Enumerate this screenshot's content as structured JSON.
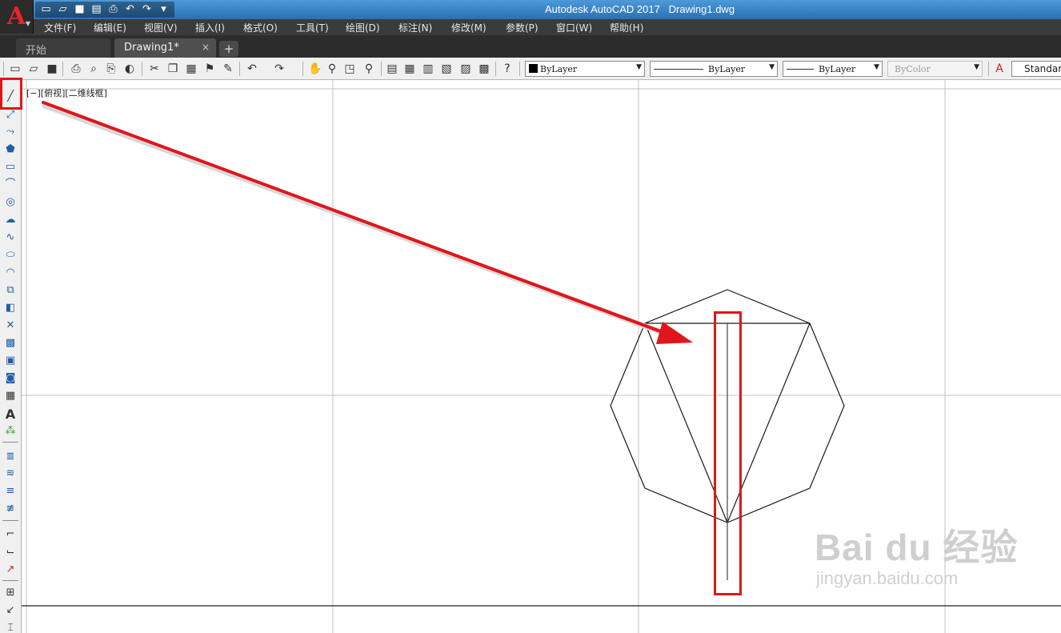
{
  "title_bar": {
    "app_name": "Autodesk AutoCAD 2017",
    "document": "Drawing1.dwg"
  },
  "app_button": {
    "letter": "A",
    "icon": "autocad-logo-icon"
  },
  "quick_access": [
    "new-icon",
    "open-icon",
    "save-icon",
    "save-as-icon",
    "plot-icon",
    "undo-icon",
    "redo-icon",
    "customize-dropdown-icon"
  ],
  "menu": [
    "文件(F)",
    "编辑(E)",
    "视图(V)",
    "插入(I)",
    "格式(O)",
    "工具(T)",
    "绘图(D)",
    "标注(N)",
    "修改(M)",
    "参数(P)",
    "窗口(W)",
    "帮助(H)"
  ],
  "tabs": [
    {
      "label": "开始",
      "active": false
    },
    {
      "label": "Drawing1*",
      "active": true,
      "close": "×"
    }
  ],
  "new_tab_label": "+",
  "toolbar": {
    "color_combo": "ByLayer",
    "linetype_combo": "ByLayer",
    "lineweight_combo": "ByLayer",
    "plotstyle_combo": "ByColor",
    "text_style": "Standard"
  },
  "left_toolbar": [
    "line-icon",
    "construction-line-icon",
    "polyline-icon",
    "polygon-icon",
    "rectangle-icon",
    "arc-icon",
    "circle-icon",
    "revision-cloud-icon",
    "spline-icon",
    "ellipse-icon",
    "ellipse-arc-icon",
    "insert-block-icon",
    "make-block-icon",
    "point-icon",
    "hatch-icon",
    "gradient-icon",
    "region-icon",
    "table-icon",
    "multiline-text-icon",
    "add-selected-icon"
  ],
  "viewport_label": "[−][俯视][二维线框]",
  "watermark": {
    "main": "Bai du 经验",
    "sub": "jingyan.baidu.com"
  },
  "colors": {
    "highlight": "#e0161b",
    "menubar": "#3b3b3b",
    "titlebar": "#2a6fb5"
  }
}
